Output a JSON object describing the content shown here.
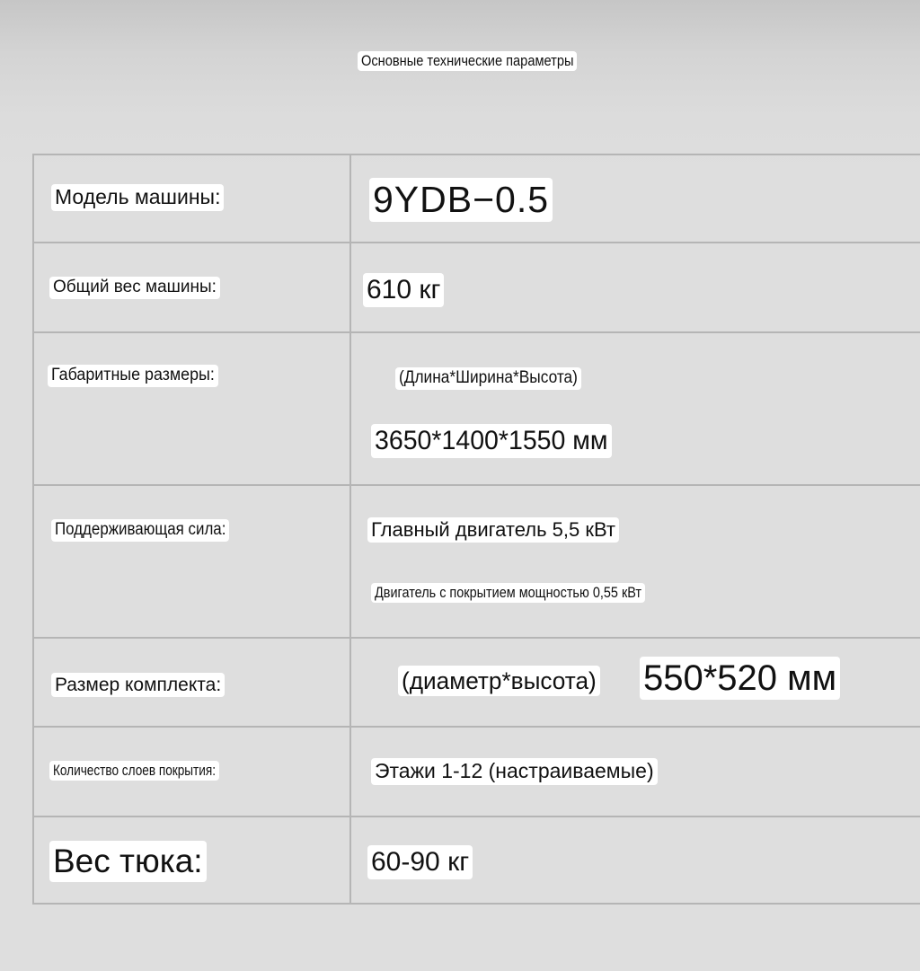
{
  "header": {
    "title": "Основные технические параметры"
  },
  "specs": [
    {
      "label": "Модель машины:",
      "values": [
        "9YDB−0.5"
      ]
    },
    {
      "label": "Общий вес машины:",
      "values": [
        "610 кг"
      ]
    },
    {
      "label": "Габаритные размеры:",
      "values": [
        "(Длина*Ширина*Высота)",
        "3650*1400*1550 мм"
      ]
    },
    {
      "label": "Поддерживающая сила:",
      "values": [
        "Главный двигатель 5,5 кВт",
        "Двигатель с покрытием мощностью 0,55 кВт"
      ]
    },
    {
      "label": "Размер комплекта:",
      "values": [
        "(диаметр*высота)",
        "550*520 мм"
      ]
    },
    {
      "label": "Количество слоев покрытия:",
      "values": [
        "Этажи 1-12 (настраиваемые)"
      ]
    },
    {
      "label": "Вес тюка:",
      "values": [
        "60-90 кг"
      ]
    }
  ]
}
